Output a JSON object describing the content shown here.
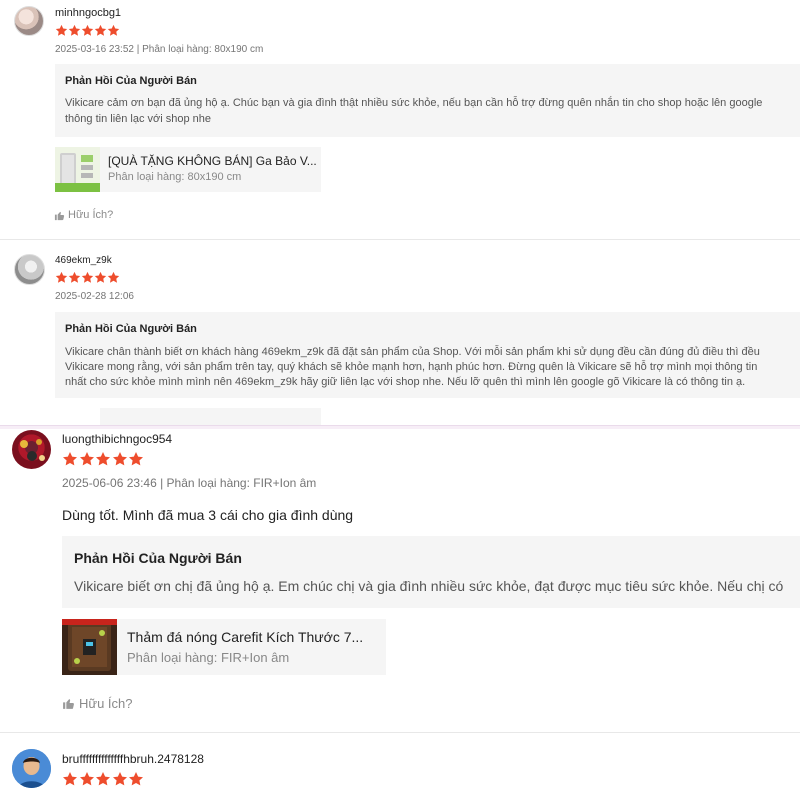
{
  "reviews": [
    {
      "username": "minhngocbg1",
      "rating": 5,
      "meta": "2025-03-16 23:52 | Phân loại hàng: 80x190 cm",
      "reply_title": "Phản Hồi Của Người Bán",
      "reply_lines": [
        "Vikicare cảm ơn bạn đã ủng hộ ạ. Chúc bạn và gia đình thật nhiều sức khỏe, nếu bạn cần hỗ trợ đừng quên nhắn tin cho shop hoặc lên google",
        "thông tin liên lạc với shop nhe"
      ],
      "product_name": "[QUÀ TẶNG KHÔNG BÁN] Ga Bảo V...",
      "product_variant": "Phân loại hàng: 80x190 cm",
      "helpful_label": "Hữu Ích?"
    },
    {
      "username": "469ekm_z9k",
      "rating": 5,
      "meta": "2025-02-28 12:06",
      "reply_title": "Phản Hồi Của Người Bán",
      "reply_lines": [
        "Vikicare chân thành biết ơn khách hàng 469ekm_z9k đã đặt sản phẩm của Shop. Với mỗi sản phẩm khi sử dụng đều cần đúng đủ điều thì đều",
        "Vikicare mong rằng, với sản phẩm trên tay, quý khách sẽ khỏe mạnh hơn, hạnh phúc hơn. Đừng quên là Vikicare sẽ hỗ trợ mình mọi thông tin",
        "nhất cho sức khỏe mình mình nên 469ekm_z9k hãy giữ liên lạc với shop nhe. Nếu lỡ quên thì mình lên google gõ Vikicare là có thông tin ạ."
      ]
    },
    {
      "username": "luongthibichngoc954",
      "rating": 5,
      "meta": "2025-06-06 23:46 | Phân loại hàng: FIR+Ion âm",
      "comment": "Dùng tốt. Mình đã mua 3 cái cho gia đình dùng",
      "reply_title": "Phản Hồi Của Người Bán",
      "reply_lines": [
        "Vikicare biết ơn chị đã ủng hộ ạ. Em chúc chị và gia đình nhiều sức khỏe, đạt được mục tiêu sức khỏe. Nếu chị có"
      ],
      "product_name": "Thảm đá nóng Carefit Kích Thước 7...",
      "product_variant": "Phân loại hàng: FIR+Ion âm",
      "helpful_label": "Hữu Ích?"
    },
    {
      "username": "bruffffffffffffffhbruh.2478128",
      "rating": 5
    }
  ],
  "colors": {
    "star": "#ee4d2d",
    "reply_bg": "#f5f5f5",
    "muted": "#757575"
  },
  "icons": {
    "rating": "star-icon",
    "helpful": "thumbs-up-icon"
  }
}
